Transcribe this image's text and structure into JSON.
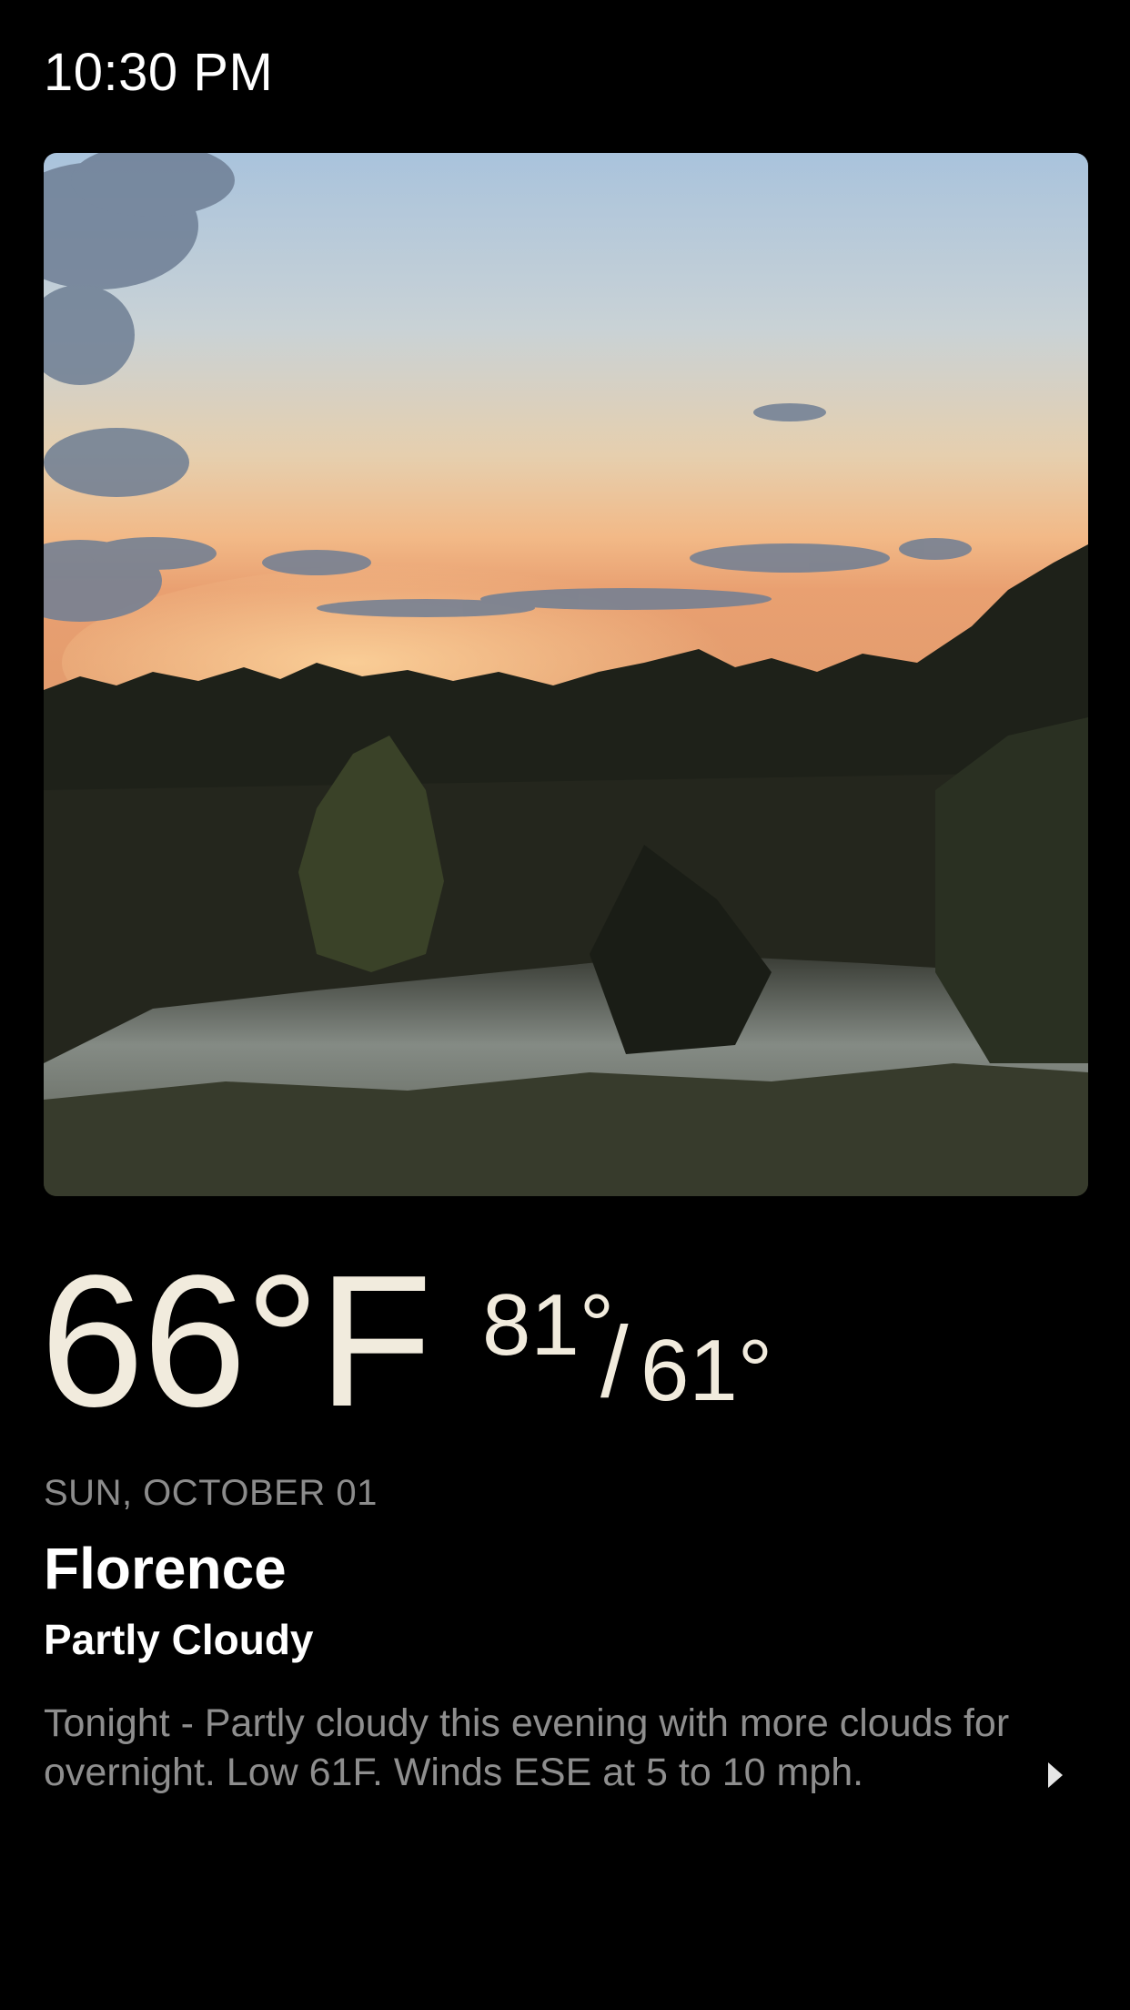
{
  "status_bar": {
    "time": "10:30 PM"
  },
  "photo": {
    "icon": "sunset-lake-photo"
  },
  "weather": {
    "current_temp": "66°F",
    "high": "81°",
    "separator": "/",
    "low": "61°",
    "date": "SUN, OCTOBER 01",
    "city": "Florence",
    "condition": "Partly Cloudy",
    "forecast": "Tonight - Partly cloudy this evening with more clouds for overnight. Low 61F. Winds ESE at 5 to 10 mph."
  },
  "colors": {
    "background": "#000000",
    "temperature": "#f1ebdd",
    "secondary_text": "#8e8e8e"
  },
  "icons": {
    "more": "chevron-right-icon"
  }
}
